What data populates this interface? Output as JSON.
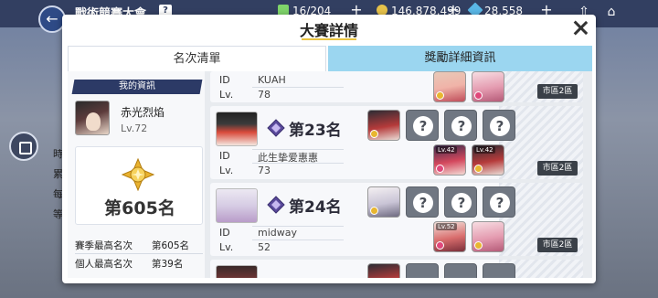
{
  "background": {
    "title": "戰術競賽大會",
    "help_icon": "question-mark-icon",
    "stamina": "16/204",
    "coins": "146,878,499",
    "gems": "28,558",
    "left_labels": [
      "時",
      "累",
      "每",
      "等"
    ]
  },
  "modal": {
    "title": "大賽詳情",
    "tabs": {
      "ranking": "名次清單",
      "rewards": "獎勵詳細資訊"
    }
  },
  "my_info": {
    "header": "我的資訊",
    "name": "赤光烈焰",
    "level": "Lv.72",
    "rank": "第605名",
    "season_best_label": "賽季最高名次",
    "season_best_value": "第605名",
    "personal_best_label": "個人最高名次",
    "personal_best_value": "第39名"
  },
  "entries": [
    {
      "id_label": "ID",
      "id": "KUAH",
      "lv_label": "Lv.",
      "lv": "78",
      "district": "市區2區"
    },
    {
      "rank": "第23名",
      "id_label": "ID",
      "id": "此生挚爱惠惠",
      "lv_label": "Lv.",
      "lv": "73",
      "district": "市區2區",
      "card_levels": [
        "Lv.42",
        "Lv.42"
      ]
    },
    {
      "rank": "第24名",
      "id_label": "ID",
      "id": "midway",
      "lv_label": "Lv.",
      "lv": "52",
      "district": "市區2區",
      "card_levels": [
        "Lv.52",
        ""
      ]
    }
  ],
  "unknown_card_glyph": "?",
  "colors": {
    "tab_active": "#ffffff",
    "tab_inactive": "#9bd6f0",
    "title_underline": "#e8c341",
    "header_navy": "#2c3a66"
  }
}
